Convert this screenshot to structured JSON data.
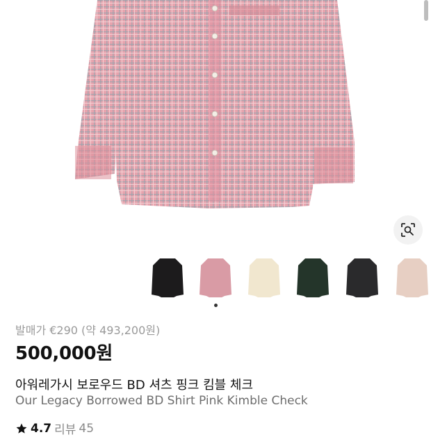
{
  "product": {
    "original_price": "발매가 €290 (약 493,200원)",
    "price": "500,000원",
    "title_ko": "아워레가시 보로우드 BD 셔츠 핑크 킴블 체크",
    "title_en": "Our Legacy Borrowed BD Shirt Pink Kimble Check"
  },
  "rating": {
    "value": "4.7",
    "label": "리뷰",
    "count": "45"
  },
  "gallery": {
    "thumbnails": [
      {
        "name": "black"
      },
      {
        "name": "pink-check"
      },
      {
        "name": "cream-check"
      },
      {
        "name": "green-check"
      },
      {
        "name": "black-2"
      },
      {
        "name": "beige-check"
      }
    ],
    "page_dots": 1
  },
  "colors": {
    "shirt_pink": "#e39aa4",
    "check_grey": "#8a8f9a",
    "price": "#111111",
    "muted": "#9a9a9a"
  }
}
